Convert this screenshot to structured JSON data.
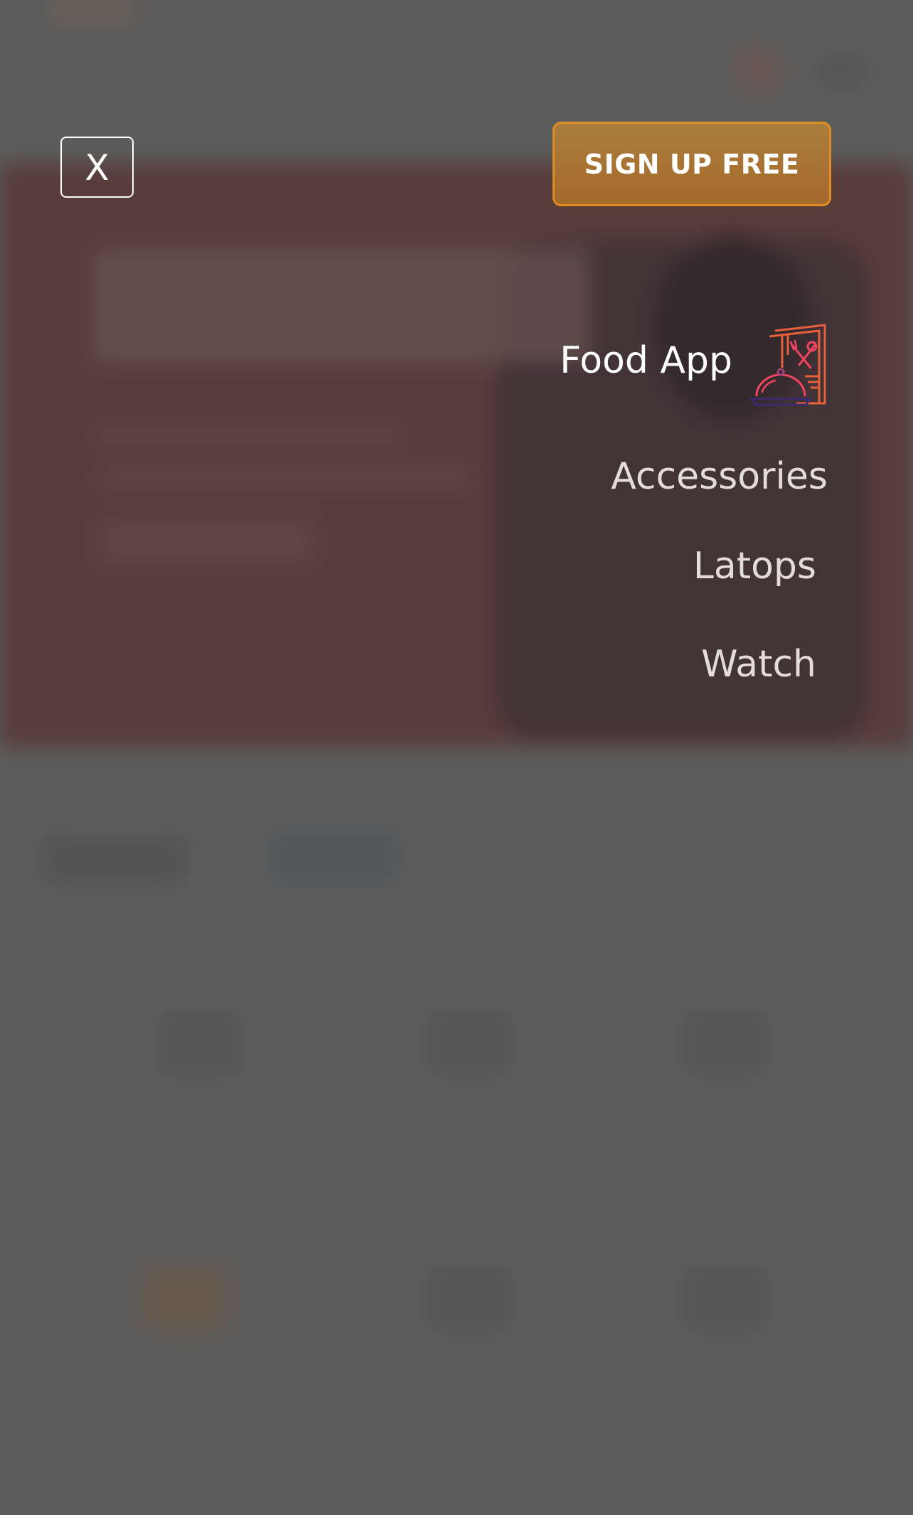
{
  "header": {
    "close_label": "X",
    "signup_label": "SIGN UP FREE"
  },
  "menu": {
    "items": [
      {
        "label": "Food App",
        "icon": "food-menu-icon"
      },
      {
        "label": "Accessories"
      },
      {
        "label": "Latops"
      },
      {
        "label": "Watch"
      }
    ]
  },
  "colors": {
    "overlay": "#5f5f5f",
    "signup_fill": "#a6692b",
    "signup_border": "#e08e23",
    "icon_orange": "#e8603a",
    "icon_pink": "#f2445e",
    "icon_navy": "#3c2a6e"
  }
}
